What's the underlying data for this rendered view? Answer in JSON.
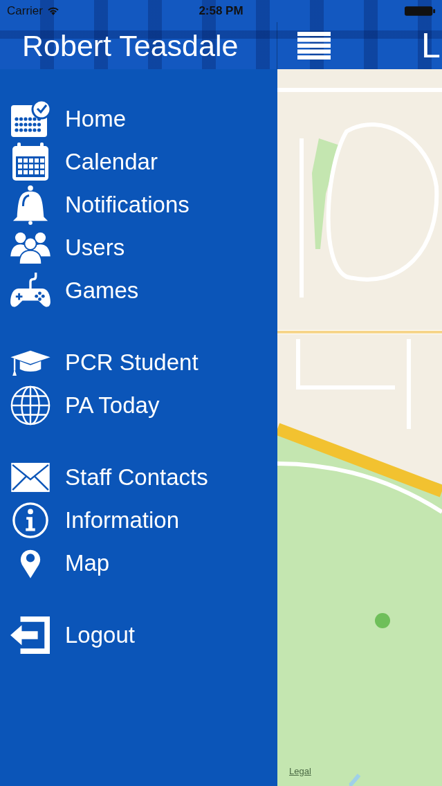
{
  "status_bar": {
    "carrier": "Carrier",
    "time": "2:58 PM"
  },
  "drawer": {
    "title": "Robert Teasdale",
    "groups": [
      {
        "items": [
          {
            "label": "Home",
            "kind": "home"
          },
          {
            "label": "Calendar",
            "kind": "calendar"
          },
          {
            "label": "Notifications",
            "kind": "bell"
          },
          {
            "label": "Users",
            "kind": "users"
          },
          {
            "label": "Games",
            "kind": "gamepad"
          }
        ]
      },
      {
        "items": [
          {
            "label": "PCR Student",
            "kind": "cap"
          },
          {
            "label": "PA Today",
            "kind": "globe"
          }
        ]
      },
      {
        "items": [
          {
            "label": "Staff Contacts",
            "kind": "mail"
          },
          {
            "label": "Information",
            "kind": "info"
          },
          {
            "label": "Map",
            "kind": "pin"
          }
        ]
      },
      {
        "items": [
          {
            "label": "Logout",
            "kind": "logout"
          }
        ]
      }
    ]
  },
  "main": {
    "title": "L",
    "map": {
      "legal": "Legal"
    }
  }
}
